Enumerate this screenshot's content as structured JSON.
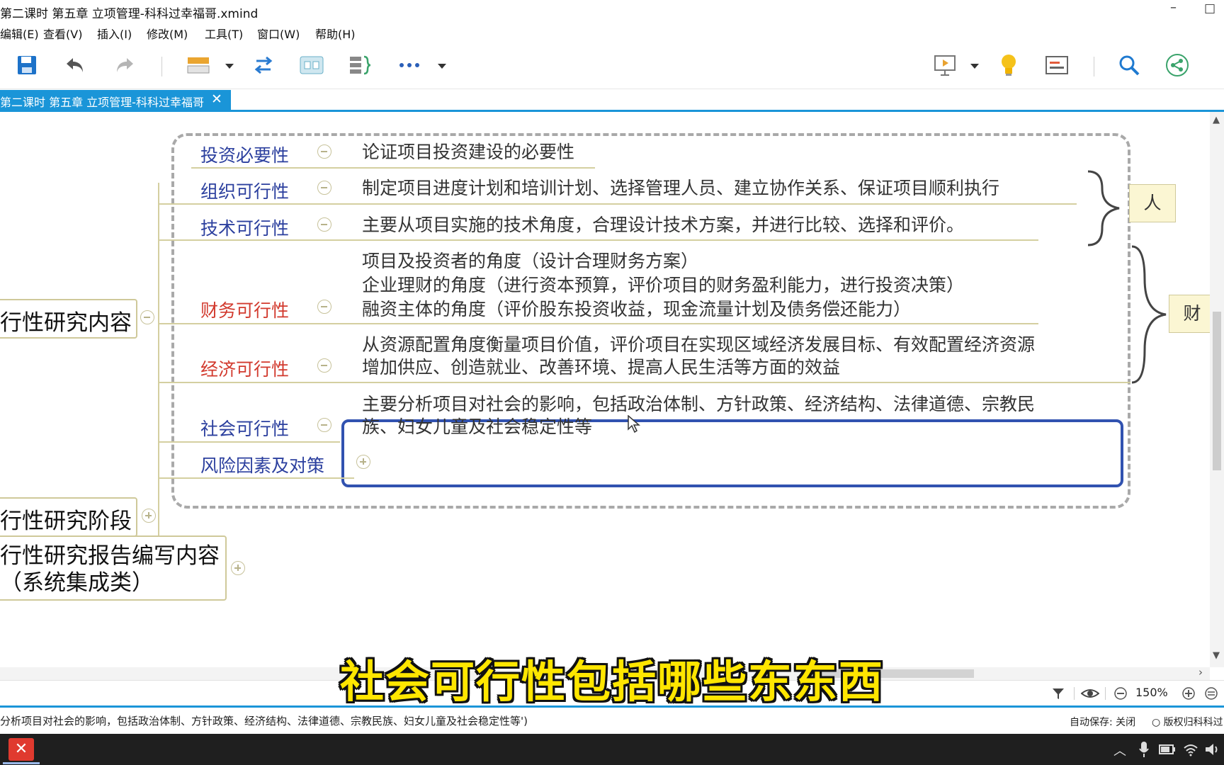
{
  "window": {
    "title": "第二课时 第五章  立项管理-科科过幸福哥.xmind",
    "minimize_glyph": "–",
    "maximize_glyph": "□"
  },
  "menu": {
    "items": [
      "编辑(E)",
      "查看(V)",
      "插入(I)",
      "修改(M)",
      "工具(T)",
      "窗口(W)",
      "帮助(H)"
    ]
  },
  "toolbar": {
    "icons": [
      "save-icon",
      "undo-icon",
      "redo-icon",
      "structure-icon",
      "relationship-icon",
      "boundary-icon",
      "summary-icon",
      "more-icon",
      "presentation-icon",
      "idea-icon",
      "notes-icon",
      "search-icon",
      "share-icon"
    ]
  },
  "tab": {
    "label": "第二课时 第五章  立项管理-科科过幸福哥",
    "close": "✕"
  },
  "mindmap": {
    "main_nodes": [
      {
        "label": "行性研究内容"
      },
      {
        "label": "行性研究阶段"
      },
      {
        "label_line1": "行性研究报告编写内容",
        "label_line2": "（系统集成类）"
      }
    ],
    "topics": [
      {
        "label": "投资必要性",
        "desc": [
          "论证项目投资建设的必要性"
        ]
      },
      {
        "label": "组织可行性",
        "desc": [
          "制定项目进度计划和培训计划、选择管理人员、建立协作关系、保证项目顺利执行"
        ]
      },
      {
        "label": "技术可行性",
        "desc": [
          "主要从项目实施的技术角度，合理设计技术方案，并进行比较、选择和评价。"
        ]
      },
      {
        "label": "财务可行性",
        "desc": [
          "项目及投资者的角度（设计合理财务方案）",
          "企业理财的角度（进行资本预算，评价项目的财务盈利能力，进行投资决策）",
          "融资主体的角度（评价股东投资收益，现金流量计划及债务偿还能力）"
        ]
      },
      {
        "label": "经济可行性",
        "desc": [
          "从资源配置角度衡量项目价值，评价项目在实现区域经济发展目标、有效配置经济资源",
          "增加供应、创造就业、改善环境、提高人民生活等方面的效益"
        ]
      },
      {
        "label": "社会可行性",
        "desc": [
          "主要分析项目对社会的影响，包括政治体制、方针政策、经济结构、法律道德、宗教民",
          "族、妇女儿童及社会稳定性等"
        ]
      },
      {
        "label": "风险因素及对策",
        "desc": []
      }
    ],
    "summaries": [
      {
        "label": "人"
      },
      {
        "label": "财"
      }
    ]
  },
  "subtitle": "社会可行性包括哪些东东西",
  "zoom": {
    "level": "150%"
  },
  "status": {
    "message": "分析项目对社会的影响，包括政治体制、方针政策、经济结构、法律道德、宗教民族、妇女儿童及社会稳定性等')",
    "autosave": "自动保存: 关闭",
    "copyright": "○ 版权归科科过"
  },
  "colors": {
    "accent": "#1a95d8",
    "topic_blue": "#2b3f9e",
    "topic_red": "#d23a2e",
    "selection": "#3152b0",
    "subtitle": "#ffe600"
  }
}
